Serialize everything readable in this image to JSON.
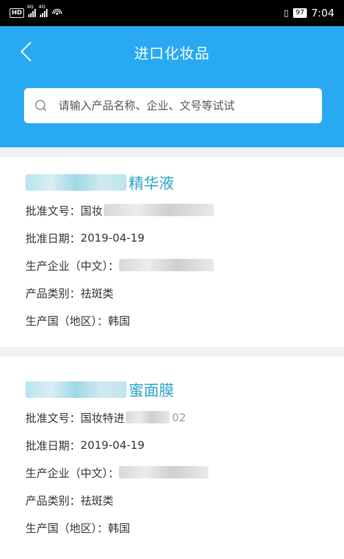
{
  "status_bar": {
    "hd": "HD",
    "net1": "4G",
    "net2": "4G",
    "battery": "97",
    "time": "7:04"
  },
  "header": {
    "title": "进口化妆品",
    "search_placeholder": "请输入产品名称、企业、文号等试试"
  },
  "products": [
    {
      "name_visible": "精华液",
      "approval_no_label": "批准文号：",
      "approval_no_value": "国妆",
      "approval_date_label": "批准日期：",
      "approval_date_value": "2019-04-19",
      "manufacturer_label": "生产企业（中文）：",
      "category_label": "产品类别：",
      "category_value": "祛斑类",
      "country_label": "生产国（地区）：",
      "country_value": "韩国"
    },
    {
      "name_visible": "蜜面膜",
      "approval_no_label": "批准文号：",
      "approval_no_value": "国妆特进",
      "approval_no_suffix": "02",
      "approval_date_label": "批准日期：",
      "approval_date_value": "2019-04-19",
      "manufacturer_label": "生产企业（中文）：",
      "category_label": "产品类别：",
      "category_value": "祛斑类",
      "country_label": "生产国（地区）：",
      "country_value": "韩国"
    }
  ],
  "colors": {
    "header_bg": "#28a9f2",
    "product_name": "#2aa5c8",
    "status_bar_bg": "#000000"
  }
}
